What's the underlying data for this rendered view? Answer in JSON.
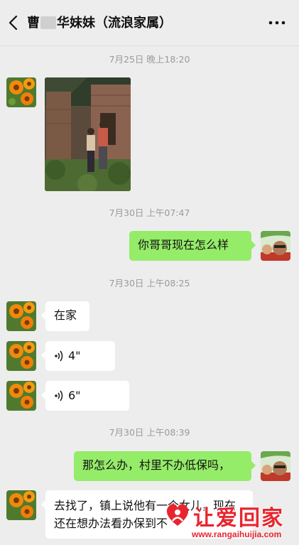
{
  "header": {
    "title_prefix": "曹",
    "title_suffix": "华妹妹（流浪家属）"
  },
  "messages": {
    "ts1": "7月25日 晚上18:20",
    "ts2": "7月30日 上午07:47",
    "out1": "你哥哥现在怎么样",
    "ts3": "7月30日 上午08:25",
    "in1": "在家",
    "voice1": "4\"",
    "voice2": "6\"",
    "ts4": "7月30日 上午08:39",
    "out2": "那怎么办，村里不办低保吗，",
    "in2": "去找了，镇上说他有一个女儿，现在还在想办法看办保到不"
  },
  "watermark": {
    "text": "让爱回家",
    "url": "www.rangaihuijia.com"
  },
  "colors": {
    "outgoing_bubble": "#95ec69",
    "incoming_bubble": "#ffffff",
    "background": "#ededed",
    "watermark": "#e8252f"
  },
  "icons": {
    "back": "chevron-left-icon",
    "more": "more-dots-icon",
    "voice": "voice-wave-icon"
  }
}
